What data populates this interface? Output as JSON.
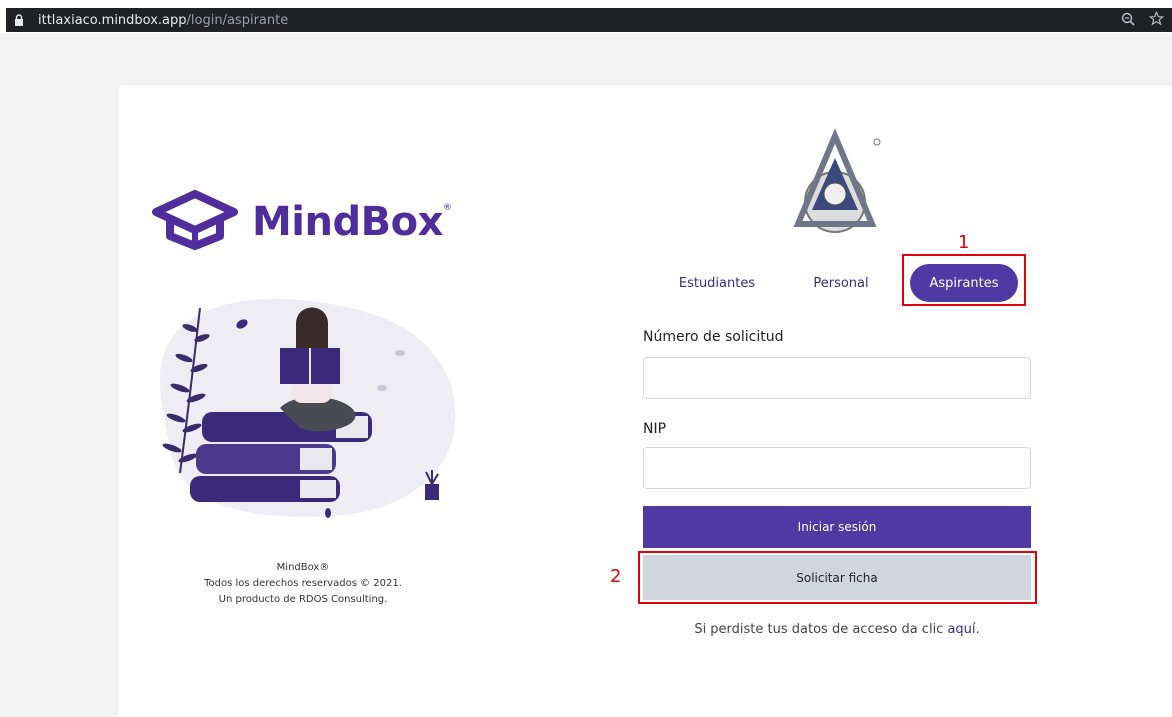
{
  "browser": {
    "url_host": "ittlaxiaco.mindbox.app",
    "url_path": "/login/aspirante",
    "icons": [
      "lock-icon",
      "zoom-icon",
      "bookmark-star-icon"
    ]
  },
  "brand": {
    "name": "MindBox",
    "reg_mark": "®",
    "color": "#4f2d9c"
  },
  "footer": {
    "line1": "MindBox®",
    "line2": "Todos los derechos reservados © 2021.",
    "line3": "Un producto de RDOS Consulting."
  },
  "tabs": {
    "estudiantes": "Estudiantes",
    "personal": "Personal",
    "aspirantes": "Aspirantes",
    "active": "Aspirantes"
  },
  "form": {
    "numero_label": "Número de solicitud",
    "numero_value": "",
    "nip_label": "NIP",
    "nip_value": "",
    "login_button": "Iniciar sesión",
    "ficha_button": "Solicitar ficha",
    "recover_text": "Si perdiste tus datos de acceso da clic ",
    "recover_link": "aquí",
    "recover_end": "."
  },
  "annotations": {
    "marker1": "1",
    "marker2": "2",
    "color": "#e0000e"
  },
  "colors": {
    "primary": "#4f3aa3",
    "secondary_button": "#cfd6de"
  }
}
